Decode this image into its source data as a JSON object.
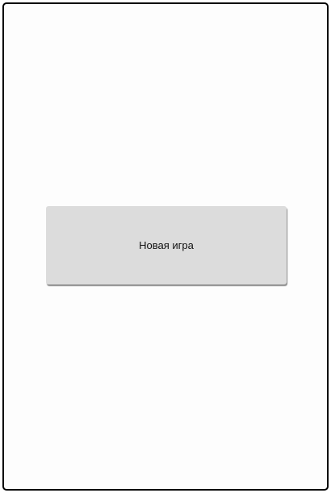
{
  "main": {
    "new_game_label": "Новая игра"
  }
}
